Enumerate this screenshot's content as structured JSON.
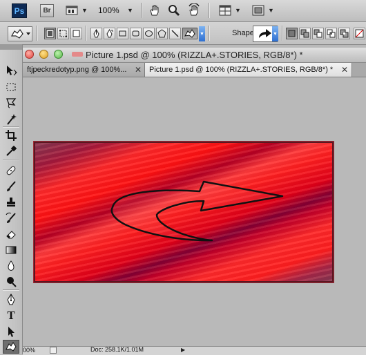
{
  "appbar": {
    "logo": "Ps",
    "bridge": "Br",
    "zoom": "100%",
    "icons": [
      "mini-bridge-icon",
      "hand-icon",
      "zoom-icon",
      "rotate-view-icon",
      "arrange-documents-icon",
      "screen-mode-icon"
    ]
  },
  "options": {
    "shape_label": "Shape:",
    "mode_icons": [
      "shape-layers-icon",
      "paths-icon",
      "fill-pixels-icon"
    ],
    "tool_icons": [
      "pen-icon",
      "freeform-pen-icon",
      "rectangle-icon",
      "rounded-rectangle-icon",
      "ellipse-icon",
      "polygon-icon",
      "line-icon",
      "custom-shape-icon"
    ],
    "combine_icons": [
      "new-shape-layer-icon",
      "add-to-shape-icon",
      "subtract-shape-icon",
      "intersect-shape-icon",
      "exclude-shape-icon"
    ]
  },
  "toolbar": {
    "tools": [
      "move-tool-icon",
      "marquee-tool-icon",
      "lasso-tool-icon",
      "quick-selection-icon",
      "crop-tool-icon",
      "eyedropper-icon",
      "healing-brush-icon",
      "brush-icon",
      "clone-stamp-icon",
      "history-brush-icon",
      "eraser-icon",
      "gradient-icon",
      "blur-icon",
      "dodge-icon",
      "pen-tool-icon",
      "type-tool-icon",
      "path-selection-icon",
      "custom-shape-tool-icon"
    ],
    "active": "custom-shape-tool-icon"
  },
  "document": {
    "window_title": "Picture 1.psd @ 100% (RIZZLA+.STORIES, RGB/8*) *",
    "tabs": [
      {
        "label": "ftjpeckredotyp.png @ 100%...",
        "active": false
      },
      {
        "label": "Picture 1.psd @ 100% (RIZZLA+.STORIES, RGB/8*) *",
        "active": true
      }
    ],
    "close_glyph": "✕"
  },
  "status": {
    "zoom": "00%",
    "doc": "Doc: 258.1K/1.01M"
  },
  "colors": {
    "accent_blue": "#2e6fd1",
    "traffic_close": "#e0443e",
    "traffic_min": "#dea123",
    "traffic_max": "#58b74a"
  }
}
